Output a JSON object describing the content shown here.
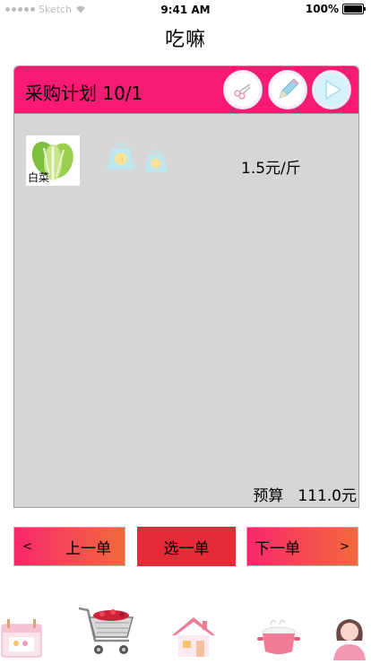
{
  "status_bar": {
    "carrier": "Sketch",
    "time": "9:41 AM",
    "battery": "100%"
  },
  "app": {
    "title": "吃嘛"
  },
  "plan": {
    "title": "采购计划 10/1",
    "actions": [
      {
        "name": "scissors",
        "icon": "scissors-icon"
      },
      {
        "name": "edit",
        "icon": "pencil-icon"
      },
      {
        "name": "play",
        "icon": "play-icon"
      }
    ],
    "items": [
      {
        "name": "白菜",
        "price": "1.5元/斤",
        "icon": "cabbage-icon"
      }
    ],
    "budget_label": "预算",
    "budget_value": "111.0元"
  },
  "buttons": {
    "prev_arrow": "<",
    "prev": "上一单",
    "select": "选一单",
    "next": "下一单",
    "next_arrow": ">"
  },
  "tabs": [
    {
      "name": "calendar",
      "icon": "calendar-icon"
    },
    {
      "name": "cart",
      "icon": "shopping-cart-icon",
      "active": true
    },
    {
      "name": "home",
      "icon": "house-icon"
    },
    {
      "name": "cook",
      "icon": "cooking-pot-icon"
    },
    {
      "name": "profile",
      "icon": "person-icon"
    }
  ],
  "colors": {
    "header": "#f81a73",
    "panel": "#d6d6d6",
    "select_button": "#e62a37",
    "gradient_start": "#f8276c",
    "gradient_end": "#f26a3c"
  }
}
